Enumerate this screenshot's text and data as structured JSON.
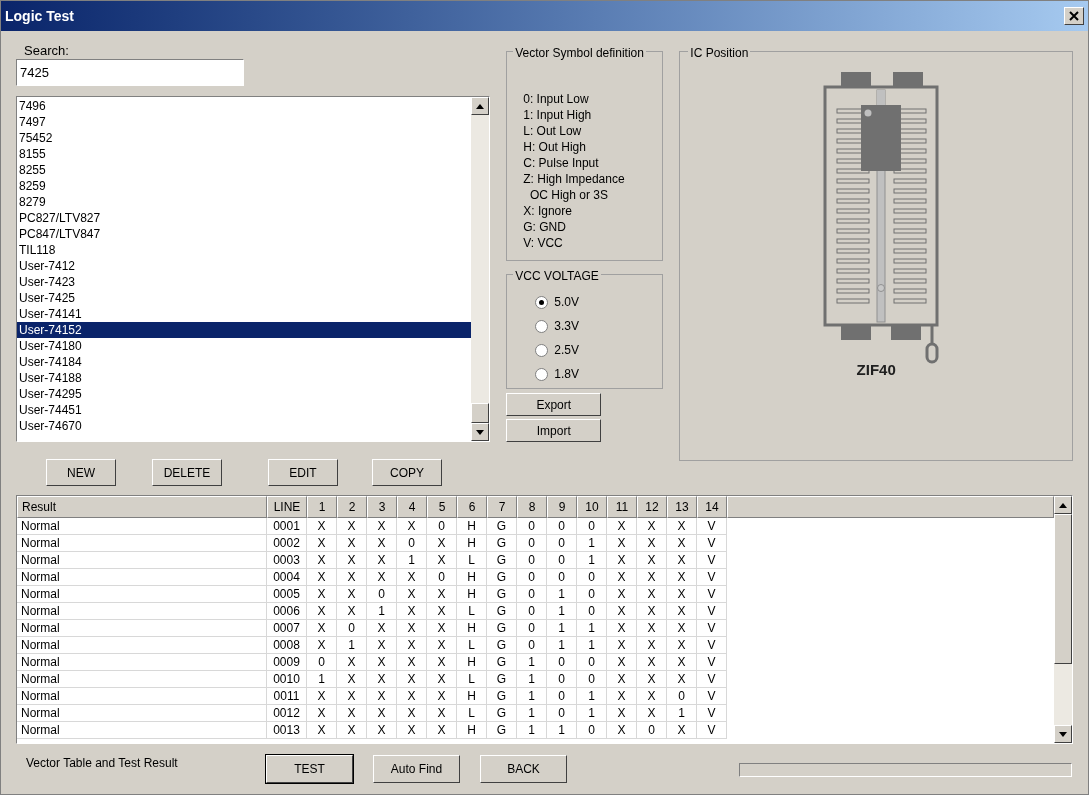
{
  "window": {
    "title": "Logic Test"
  },
  "search": {
    "label": "Search:",
    "value": "7425"
  },
  "device_list": [
    {
      "label": "7496",
      "selected": false
    },
    {
      "label": "7497",
      "selected": false
    },
    {
      "label": "75452",
      "selected": false
    },
    {
      "label": "8155",
      "selected": false
    },
    {
      "label": "8255",
      "selected": false
    },
    {
      "label": "8259",
      "selected": false
    },
    {
      "label": "8279",
      "selected": false
    },
    {
      "label": "PC827/LTV827",
      "selected": false
    },
    {
      "label": "PC847/LTV847",
      "selected": false
    },
    {
      "label": "TIL118",
      "selected": false
    },
    {
      "label": "User-7412",
      "selected": false
    },
    {
      "label": "User-7423",
      "selected": false
    },
    {
      "label": "User-7425",
      "selected": false
    },
    {
      "label": "User-74141",
      "selected": false
    },
    {
      "label": "User-74152",
      "selected": true
    },
    {
      "label": "User-74180",
      "selected": false
    },
    {
      "label": "User-74184",
      "selected": false
    },
    {
      "label": "User-74188",
      "selected": false
    },
    {
      "label": "User-74295",
      "selected": false
    },
    {
      "label": "User-74451",
      "selected": false
    },
    {
      "label": "User-74670",
      "selected": false
    }
  ],
  "list_buttons": [
    "NEW",
    "DELETE",
    "EDIT",
    "COPY"
  ],
  "vector_symbols": {
    "title": "Vector Symbol definition",
    "lines": [
      "0: Input Low",
      "1: Input High",
      "L: Out Low",
      "H: Out High",
      "C: Pulse Input",
      "Z: High Impedance",
      "  OC High or 3S",
      "X: Ignore",
      "G: GND",
      "V: VCC"
    ]
  },
  "vcc_voltage": {
    "title": "VCC VOLTAGE",
    "options": [
      {
        "label": "5.0V",
        "selected": true
      },
      {
        "label": "3.3V",
        "selected": false
      },
      {
        "label": "2.5V",
        "selected": false
      },
      {
        "label": "1.8V",
        "selected": false
      }
    ]
  },
  "io_buttons": [
    "Export",
    "Import"
  ],
  "ic_position": {
    "title": "IC Position",
    "socket": "ZIF40"
  },
  "table": {
    "columns": [
      "Result",
      "LINE",
      "1",
      "2",
      "3",
      "4",
      "5",
      "6",
      "7",
      "8",
      "9",
      "10",
      "11",
      "12",
      "13",
      "14"
    ],
    "rows": [
      [
        "Normal",
        "0001",
        "X",
        "X",
        "X",
        "X",
        "0",
        "H",
        "G",
        "0",
        "0",
        "0",
        "X",
        "X",
        "X",
        "V"
      ],
      [
        "Normal",
        "0002",
        "X",
        "X",
        "X",
        "0",
        "X",
        "H",
        "G",
        "0",
        "0",
        "1",
        "X",
        "X",
        "X",
        "V"
      ],
      [
        "Normal",
        "0003",
        "X",
        "X",
        "X",
        "1",
        "X",
        "L",
        "G",
        "0",
        "0",
        "1",
        "X",
        "X",
        "X",
        "V"
      ],
      [
        "Normal",
        "0004",
        "X",
        "X",
        "X",
        "X",
        "0",
        "H",
        "G",
        "0",
        "0",
        "0",
        "X",
        "X",
        "X",
        "V"
      ],
      [
        "Normal",
        "0005",
        "X",
        "X",
        "0",
        "X",
        "X",
        "H",
        "G",
        "0",
        "1",
        "0",
        "X",
        "X",
        "X",
        "V"
      ],
      [
        "Normal",
        "0006",
        "X",
        "X",
        "1",
        "X",
        "X",
        "L",
        "G",
        "0",
        "1",
        "0",
        "X",
        "X",
        "X",
        "V"
      ],
      [
        "Normal",
        "0007",
        "X",
        "0",
        "X",
        "X",
        "X",
        "H",
        "G",
        "0",
        "1",
        "1",
        "X",
        "X",
        "X",
        "V"
      ],
      [
        "Normal",
        "0008",
        "X",
        "1",
        "X",
        "X",
        "X",
        "L",
        "G",
        "0",
        "1",
        "1",
        "X",
        "X",
        "X",
        "V"
      ],
      [
        "Normal",
        "0009",
        "0",
        "X",
        "X",
        "X",
        "X",
        "H",
        "G",
        "1",
        "0",
        "0",
        "X",
        "X",
        "X",
        "V"
      ],
      [
        "Normal",
        "0010",
        "1",
        "X",
        "X",
        "X",
        "X",
        "L",
        "G",
        "1",
        "0",
        "0",
        "X",
        "X",
        "X",
        "V"
      ],
      [
        "Normal",
        "0011",
        "X",
        "X",
        "X",
        "X",
        "X",
        "H",
        "G",
        "1",
        "0",
        "1",
        "X",
        "X",
        "0",
        "V"
      ],
      [
        "Normal",
        "0012",
        "X",
        "X",
        "X",
        "X",
        "X",
        "L",
        "G",
        "1",
        "0",
        "1",
        "X",
        "X",
        "1",
        "V"
      ],
      [
        "Normal",
        "0013",
        "X",
        "X",
        "X",
        "X",
        "X",
        "H",
        "G",
        "1",
        "1",
        "0",
        "X",
        "0",
        "X",
        "V"
      ]
    ]
  },
  "status_caption": "Vector Table and Test Result",
  "action_buttons": [
    "TEST",
    "Auto Find",
    "BACK"
  ],
  "progress": {
    "level": 0
  }
}
